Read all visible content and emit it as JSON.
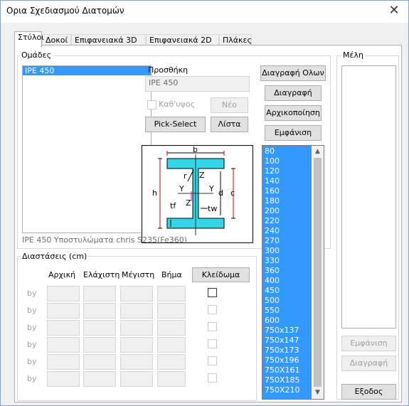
{
  "window": {
    "title": "Ορια Σχεδιασμού Διατομών",
    "close_glyph": "✕"
  },
  "tabs": [
    "Στύλοι",
    "Δοκοί",
    "Επιφανειακά 3D",
    "Επιφανειακά 2D",
    "Πλάκες"
  ],
  "groups_panel": {
    "label": "Ομάδες",
    "items": [
      "IPE 450"
    ],
    "selected_index": 0,
    "info_text": "IPE 450 Υποστυλώματα chris S235(Fe360)"
  },
  "add_section": {
    "label": "Προσθήκη",
    "name_value": "IPE 450",
    "kathypsos_label": "Καθ'υψος",
    "new_button": "Νέο",
    "pick_select_button": "Pick-Select",
    "list_button": "Λίστα"
  },
  "actions": {
    "delete_all": "Διαγραφή Ολων",
    "delete": "Διαγραφή",
    "initialize": "Αρχικοποίηση",
    "show": "Εμφάνιση"
  },
  "profile_diagram": {
    "labels": {
      "b": "b",
      "r": "r",
      "z_top": "Z",
      "h": "h",
      "y_left": "Y",
      "y_right": "Y",
      "d": "d",
      "c": "c",
      "tf": "tf",
      "z_bottom": "Z",
      "tw": "tw"
    }
  },
  "sizes_list": {
    "items": [
      "80",
      "100",
      "120",
      "140",
      "160",
      "180",
      "200",
      "220",
      "240",
      "270",
      "300",
      "330",
      "360",
      "400",
      "450",
      "500",
      "550",
      "600",
      "750x137",
      "750x147",
      "750x173",
      "750x196",
      "750X161",
      "750X185",
      "750X210"
    ]
  },
  "dimensions": {
    "label": "Διαστάσεις (cm)",
    "columns": [
      "Αρχική",
      "Ελάχιστη",
      "Μέγιστη",
      "Βήμα"
    ],
    "lock_button": "Κλείδωμα",
    "row_label": "by",
    "rows": 6
  },
  "members": {
    "label": "Μέλη",
    "show_button": "Εμφάνιση",
    "delete_button": "Διαγραφή",
    "exit_button": "Εξοδος"
  }
}
